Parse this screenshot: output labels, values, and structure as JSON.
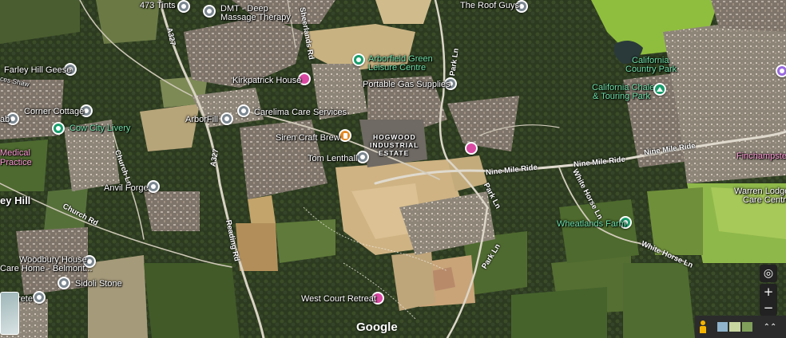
{
  "brand": "Google",
  "roads": {
    "a327_upper": "A327",
    "a327_lower": "A327",
    "reading_rd": "Reading Rd",
    "church_rd": "Church Rd",
    "church_ln": "Church Ln",
    "park_ln_top": "Park Ln",
    "park_ln_mid": "Park Ln",
    "park_ln_low": "Park Ln",
    "nine_mile_ride_1": "Nine Mile Ride",
    "nine_mile_ride_2": "Nine Mile Ride",
    "nine_mile_ride_3": "Nine Mile Ride",
    "white_horse_ln_1": "White Horse Ln",
    "white_horse_ln_2": "White Horse Ln",
    "sheerlands_rd": "Sheerlands Rd"
  },
  "places": {
    "tints": "473 Tints",
    "dmt": "DMT - Deep",
    "dmt2": "Massage Therapy",
    "roof_guys": "The Roof Guys",
    "farley_geese": "Farley Hill Geese",
    "ces_shaw": "ces Shaw",
    "arborfield_green1": "Arborfield Green",
    "arborfield_green2": "Leisure Centre",
    "kirkpatrick": "Kirkpatrick House",
    "portable_gas": "Portable Gas Supplies",
    "california_cp1": "California",
    "california_cp2": "Country Park",
    "california_chalet1": "California Chalet",
    "california_chalet2": "& Touring Park",
    "corner_cottage": "Corner Cottage",
    "ab": "ab",
    "carelima": "Carelima Care Services",
    "arborfill": "ArborFill",
    "cow_city": "Cow City Livery",
    "medical1": "Medical",
    "medical2": "Practice",
    "siren_craft": "Siren Craft Brew",
    "hogwood1": "HOGWOOD",
    "hogwood2": "INDUSTRIAL",
    "hogwood3": "ESTATE",
    "tom_lenthall": "Tom Lenthall",
    "finchampstead": "Finchampstea",
    "warren_lodge1": "Warren Lodge",
    "warren_lodge2": "Care Centre",
    "anvil_forge": "Anvil Forge",
    "ey_hill": "ey Hill",
    "wheatlands": "Wheatlands Farm",
    "woodbury1": "Woodbury House",
    "woodbury2": "Care Home - Belmont...",
    "sidoli": "Sidoli Stone",
    "rete": "rete",
    "west_court": "West Court Retreat"
  },
  "controls": {
    "locate": "◎",
    "zoom_in": "+",
    "zoom_out": "−",
    "expand": "⌃⌃"
  },
  "colors": {
    "farmland_bright": "#86b43a",
    "urban": "#8a7d70",
    "construction": "#c9b080",
    "woodland": "#2f3f22"
  }
}
